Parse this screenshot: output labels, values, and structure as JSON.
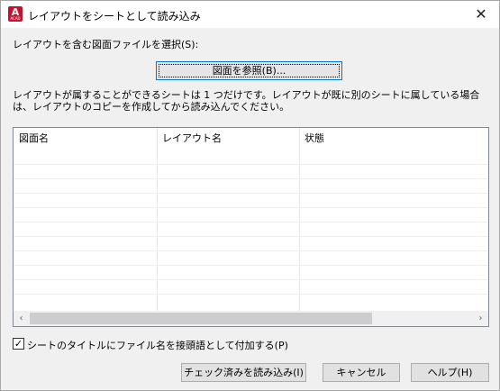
{
  "window": {
    "title": "レイアウトをシートとして読み込み",
    "icon_letter": "A",
    "icon_sub": "ACAD",
    "close_glyph": "✕"
  },
  "select_label": "レイアウトを含む図面ファイルを選択(S):",
  "browse_button": "図面を参照(B)...",
  "info_text": "レイアウトが属することができるシートは 1 つだけです。レイアウトが既に別のシートに属している場合は、レイアウトのコピーを作成してから読み込んでください。",
  "list": {
    "columns": [
      "図面名",
      "レイアウト名",
      "状態"
    ],
    "rows": []
  },
  "scrollbar": {
    "left_arrow": "‹",
    "right_arrow": "›"
  },
  "prefix_checkbox": {
    "checked": true,
    "check_glyph": "✓",
    "label": "シートのタイトルにファイル名を接頭語として付加する(P)"
  },
  "buttons": {
    "import_checked": "チェック済みを読み込み(I)",
    "cancel": "キャンセル",
    "help": "ヘルプ(H)"
  }
}
